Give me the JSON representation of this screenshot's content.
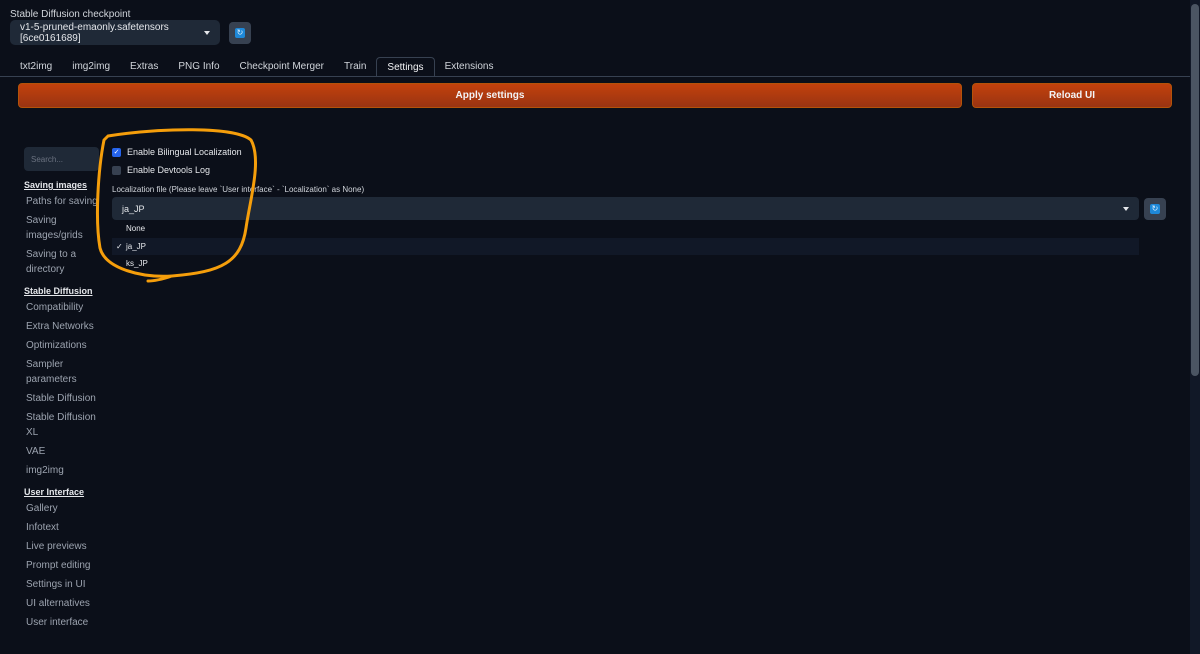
{
  "checkpoint": {
    "label": "Stable Diffusion checkpoint",
    "value": "v1-5-pruned-emaonly.safetensors [6ce0161689]"
  },
  "tabs": [
    {
      "label": "txt2img"
    },
    {
      "label": "img2img"
    },
    {
      "label": "Extras"
    },
    {
      "label": "PNG Info"
    },
    {
      "label": "Checkpoint Merger"
    },
    {
      "label": "Train"
    },
    {
      "label": "Settings"
    },
    {
      "label": "Extensions"
    }
  ],
  "active_tab": "Settings",
  "actions": {
    "apply": "Apply settings",
    "reload": "Reload UI"
  },
  "search": {
    "placeholder": "Search..."
  },
  "sidebar": {
    "sections": [
      {
        "title": "Saving images",
        "items": [
          "Paths for saving",
          "Saving images/grids",
          "Saving to a directory"
        ]
      },
      {
        "title": "Stable Diffusion",
        "items": [
          "Compatibility",
          "Extra Networks",
          "Optimizations",
          "Sampler parameters",
          "Stable Diffusion",
          "Stable Diffusion XL",
          "VAE",
          "img2img"
        ]
      },
      {
        "title": "User Interface",
        "items": [
          "Gallery",
          "Infotext",
          "Live previews",
          "Prompt editing",
          "Settings in UI",
          "UI alternatives",
          "User interface"
        ]
      }
    ]
  },
  "settings": {
    "bilingual": {
      "label": "Enable Bilingual Localization",
      "checked": true
    },
    "devtools": {
      "label": "Enable Devtools Log",
      "checked": false
    },
    "localization": {
      "label": "Localization file (Please leave `User interface` - `Localization` as None)",
      "value": "ja_JP",
      "options": [
        {
          "label": "None",
          "selected": false
        },
        {
          "label": "ja_JP",
          "selected": true
        },
        {
          "label": "ks_JP",
          "selected": false
        }
      ]
    }
  },
  "glyphs": {
    "check": "✓",
    "refresh": "↻"
  },
  "colors": {
    "background": "#0b0f19",
    "accent_orange": "#c2410c",
    "annotation": "#f59e0b",
    "checkbox": "#2563eb"
  }
}
